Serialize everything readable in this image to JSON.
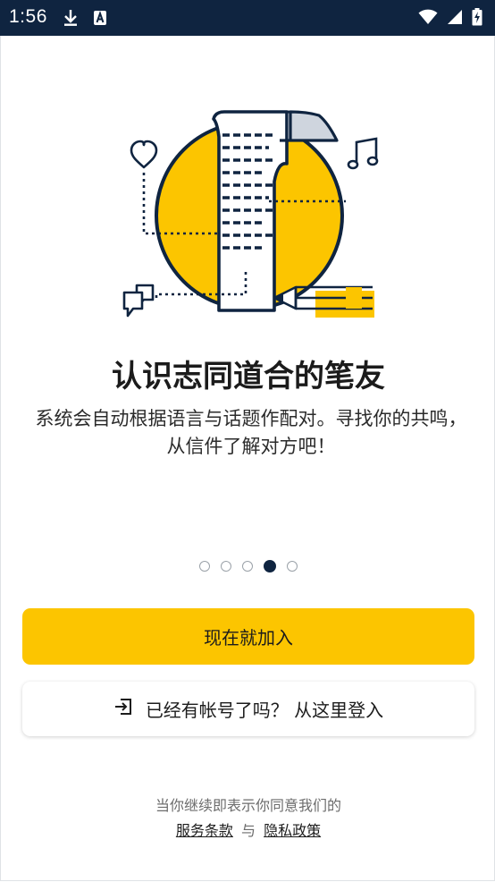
{
  "status_bar": {
    "time": "1:56",
    "icons_left": [
      "download-icon",
      "a-badge-icon"
    ],
    "icons_right": [
      "wifi-icon",
      "signal-icon",
      "battery-charging-icon"
    ]
  },
  "onboarding": {
    "illustration": "pen-pal-letter-illustration",
    "title": "认识志同道合的笔友",
    "subtitle": "系统会自动根据语言与话题作配对。寻找你的共鸣，从信件了解对方吧！",
    "pager": {
      "total": 5,
      "active_index": 3
    }
  },
  "buttons": {
    "join_label": "现在就加入",
    "login_label": "已经有帐号了吗？ 从这里登入",
    "login_icon": "login-icon"
  },
  "footer": {
    "consent_text": "当你继续即表示你同意我们的",
    "terms_label": "服务条款",
    "and_text": "与",
    "privacy_label": "隐私政策"
  },
  "colors": {
    "status_bar": "#0f2440",
    "accent_yellow": "#fcc500",
    "navy": "#0f2440"
  }
}
